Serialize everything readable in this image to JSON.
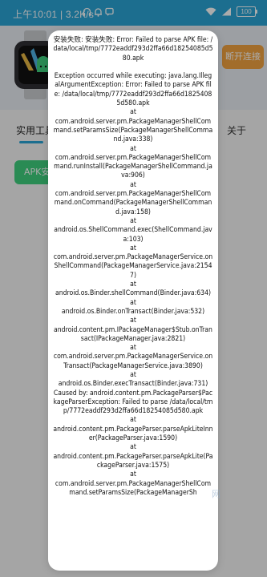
{
  "status_bar": {
    "time_and_speed": "上午10:01 | 3.2K/s",
    "battery": "100"
  },
  "header": {
    "connect_button": "断开连接"
  },
  "tabs": {
    "tools": "实用工具",
    "about": "关于"
  },
  "apk_chip": "APK安装",
  "dialog": {
    "message": "安装失败: 安装失败: Error: Failed to parse APK file: /data/local/tmp/7772eaddf293d2ffa66d18254085d580.apk\n\nException occurred while executing: java.lang.IllegalArgumentException: Error: Failed to parse APK file: /data/local/tmp/7772eaddf293d2ffa66d18254085d580.apk\nat\ncom.android.server.pm.PackageManagerShellCommand.setParamsSize(PackageManagerShellCommand.java:338)\nat\ncom.android.server.pm.PackageManagerShellCommand.runInstall(PackageManagerShellCommand.java:906)\nat\ncom.android.server.pm.PackageManagerShellCommand.onCommand(PackageManagerShellCommand.java:158)\nat\nandroid.os.ShellCommand.exec(ShellCommand.java:103)\nat\ncom.android.server.pm.PackageManagerService.onShellCommand(PackageManagerService.java:21547)\nat\nandroid.os.Binder.shellCommand(Binder.java:634)\nat\nandroid.os.Binder.onTransact(Binder.java:532)\nat\nandroid.content.pm.IPackageManager$Stub.onTransact(IPackageManager.java:2821)\nat\ncom.android.server.pm.PackageManagerService.onTransact(PackageManagerService.java:3890)\nat\nandroid.os.Binder.execTransact(Binder.java:731)\nCaused by: android.content.pm.PackageParser$PackageParserException: Failed to parse /data/local/tmp/7772eaddf293d2ffa66d18254085d580.apk\nat\nandroid.content.pm.PackageParser.parseApkLiteInner(PackageParser.java:1590)\nat\nandroid.content.pm.PackageParser.parseApkLite(PackageParser.java:1575)\nat\ncom.android.server.pm.PackageManagerShellCommand.setParamsSize(PackageManagerSh"
  },
  "watermark": "网",
  "colors": {
    "status_bar": "#2aa4d6",
    "connect_button": "#f2a341",
    "apk_chip": "#3fcf7e"
  }
}
